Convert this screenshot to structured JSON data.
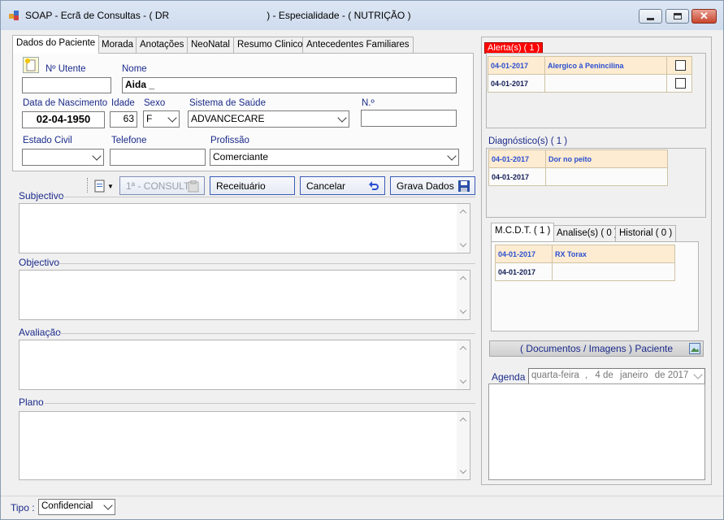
{
  "window": {
    "title": "SOAP - Ecrã de Consultas - ( DR                                    ) - Especialidade - ( NUTRIÇÃO )"
  },
  "tabs": [
    "Dados do Paciente",
    "Morada",
    "Anotações",
    "NeoNatal",
    "Resumo Clinico",
    "Antecedentes Familiares"
  ],
  "patient": {
    "utente_label": "Nº Utente",
    "utente_value": "",
    "nome_label": "Nome",
    "nome_value": "Aida                                  _",
    "nascimento_label": "Data de Nascimento",
    "nascimento_value": "02-04-1950",
    "idade_label": "Idade",
    "idade_value": "63",
    "sexo_label": "Sexo",
    "sexo_value": "F",
    "sistema_label": "Sistema de Saúde",
    "sistema_value": "ADVANCECARE",
    "numero_label": "N.º",
    "numero_value": "",
    "estado_civil_label": "Estado Civil",
    "estado_civil_value": "",
    "telefone_label": "Telefone",
    "telefone_value": "",
    "profissao_label": "Profissão",
    "profissao_value": "Comerciante"
  },
  "toolbar": {
    "consulta_label": "1ª - CONSULTA",
    "receituario_label": "Receituário",
    "cancelar_label": "Cancelar",
    "grava_label": "Grava Dados"
  },
  "soap": {
    "subjectivo": "Subjectivo",
    "objectivo": "Objectivo",
    "avaliacao": "Avaliação",
    "plano": "Plano"
  },
  "alertas": {
    "title": "Alerta(s) ( 1 )",
    "rows": [
      {
        "date": "04-01-2017",
        "text": "Alergico à Penincilina"
      },
      {
        "date": "04-01-2017",
        "text": ""
      }
    ]
  },
  "diagnosticos": {
    "title": "Diagnóstico(s) ( 1 )",
    "rows": [
      {
        "date": "04-01-2017",
        "text": "Dor no peito"
      },
      {
        "date": "04-01-2017",
        "text": ""
      }
    ]
  },
  "mcdt_tabs": [
    "M.C.D.T. ( 1 )",
    "Analise(s) ( 0 )",
    "Historial ( 0 )"
  ],
  "mcdt": {
    "rows": [
      {
        "date": "04-01-2017",
        "text": "RX Torax"
      },
      {
        "date": "04-01-2017",
        "text": ""
      }
    ]
  },
  "documentos_label": "( Documentos / Imagens ) Paciente",
  "agenda": {
    "label": "Agenda :",
    "weekday": "quarta-feira",
    "sep": ",",
    "day": "4 de",
    "month": "janeiro",
    "year": "de 2017"
  },
  "footer": {
    "tipo_label": "Tipo :",
    "tipo_value": "Confidencial"
  },
  "colors": {
    "alert_header": "#ff0000",
    "grid_highlight": "#fdebd2",
    "link_blue": "#2a4fd0",
    "label_blue": "#1a2a8a"
  }
}
